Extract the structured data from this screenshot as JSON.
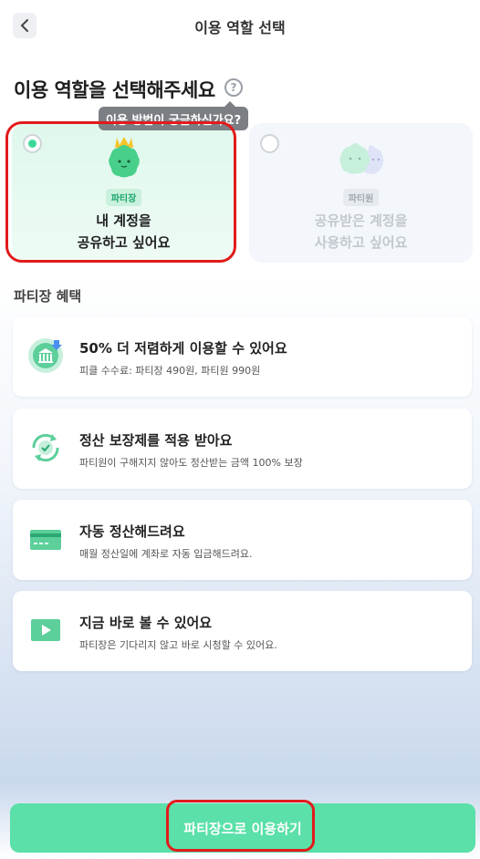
{
  "header": {
    "title": "이용 역할 선택"
  },
  "page_title": "이용 역할을 선택해주세요",
  "help": {
    "icon": "?",
    "tooltip": "이용 방법이 궁금하신가요?"
  },
  "roles": [
    {
      "badge": "파티장",
      "line1": "내 계정을",
      "line2": "공유하고 싶어요",
      "selected": true
    },
    {
      "badge": "파티원",
      "line1": "공유받은 계정을",
      "line2": "사용하고 싶어요",
      "selected": false
    }
  ],
  "benefits_title": "파티장 혜택",
  "benefits": [
    {
      "title": "50% 더 저렴하게 이용할 수 있어요",
      "desc": "피클 수수료: 파티장 490원, 파티원 990원",
      "icon": "bank-discount-icon"
    },
    {
      "title": "정산 보장제를 적용 받아요",
      "desc": "파티원이 구해지지 않아도 정산받는 금액 100% 보장",
      "icon": "settlement-guarantee-icon"
    },
    {
      "title": "자동 정산해드려요",
      "desc": "매월 정산일에 계좌로 자동 입금해드려요.",
      "icon": "card-icon"
    },
    {
      "title": "지금 바로 볼 수 있어요",
      "desc": "파티장은 기다리지 않고 바로 시청할 수 있어요.",
      "icon": "play-icon"
    }
  ],
  "cta": {
    "label": "파티장으로 이용하기"
  },
  "colors": {
    "accent": "#5ae0a8",
    "highlight": "#e21b1b"
  }
}
